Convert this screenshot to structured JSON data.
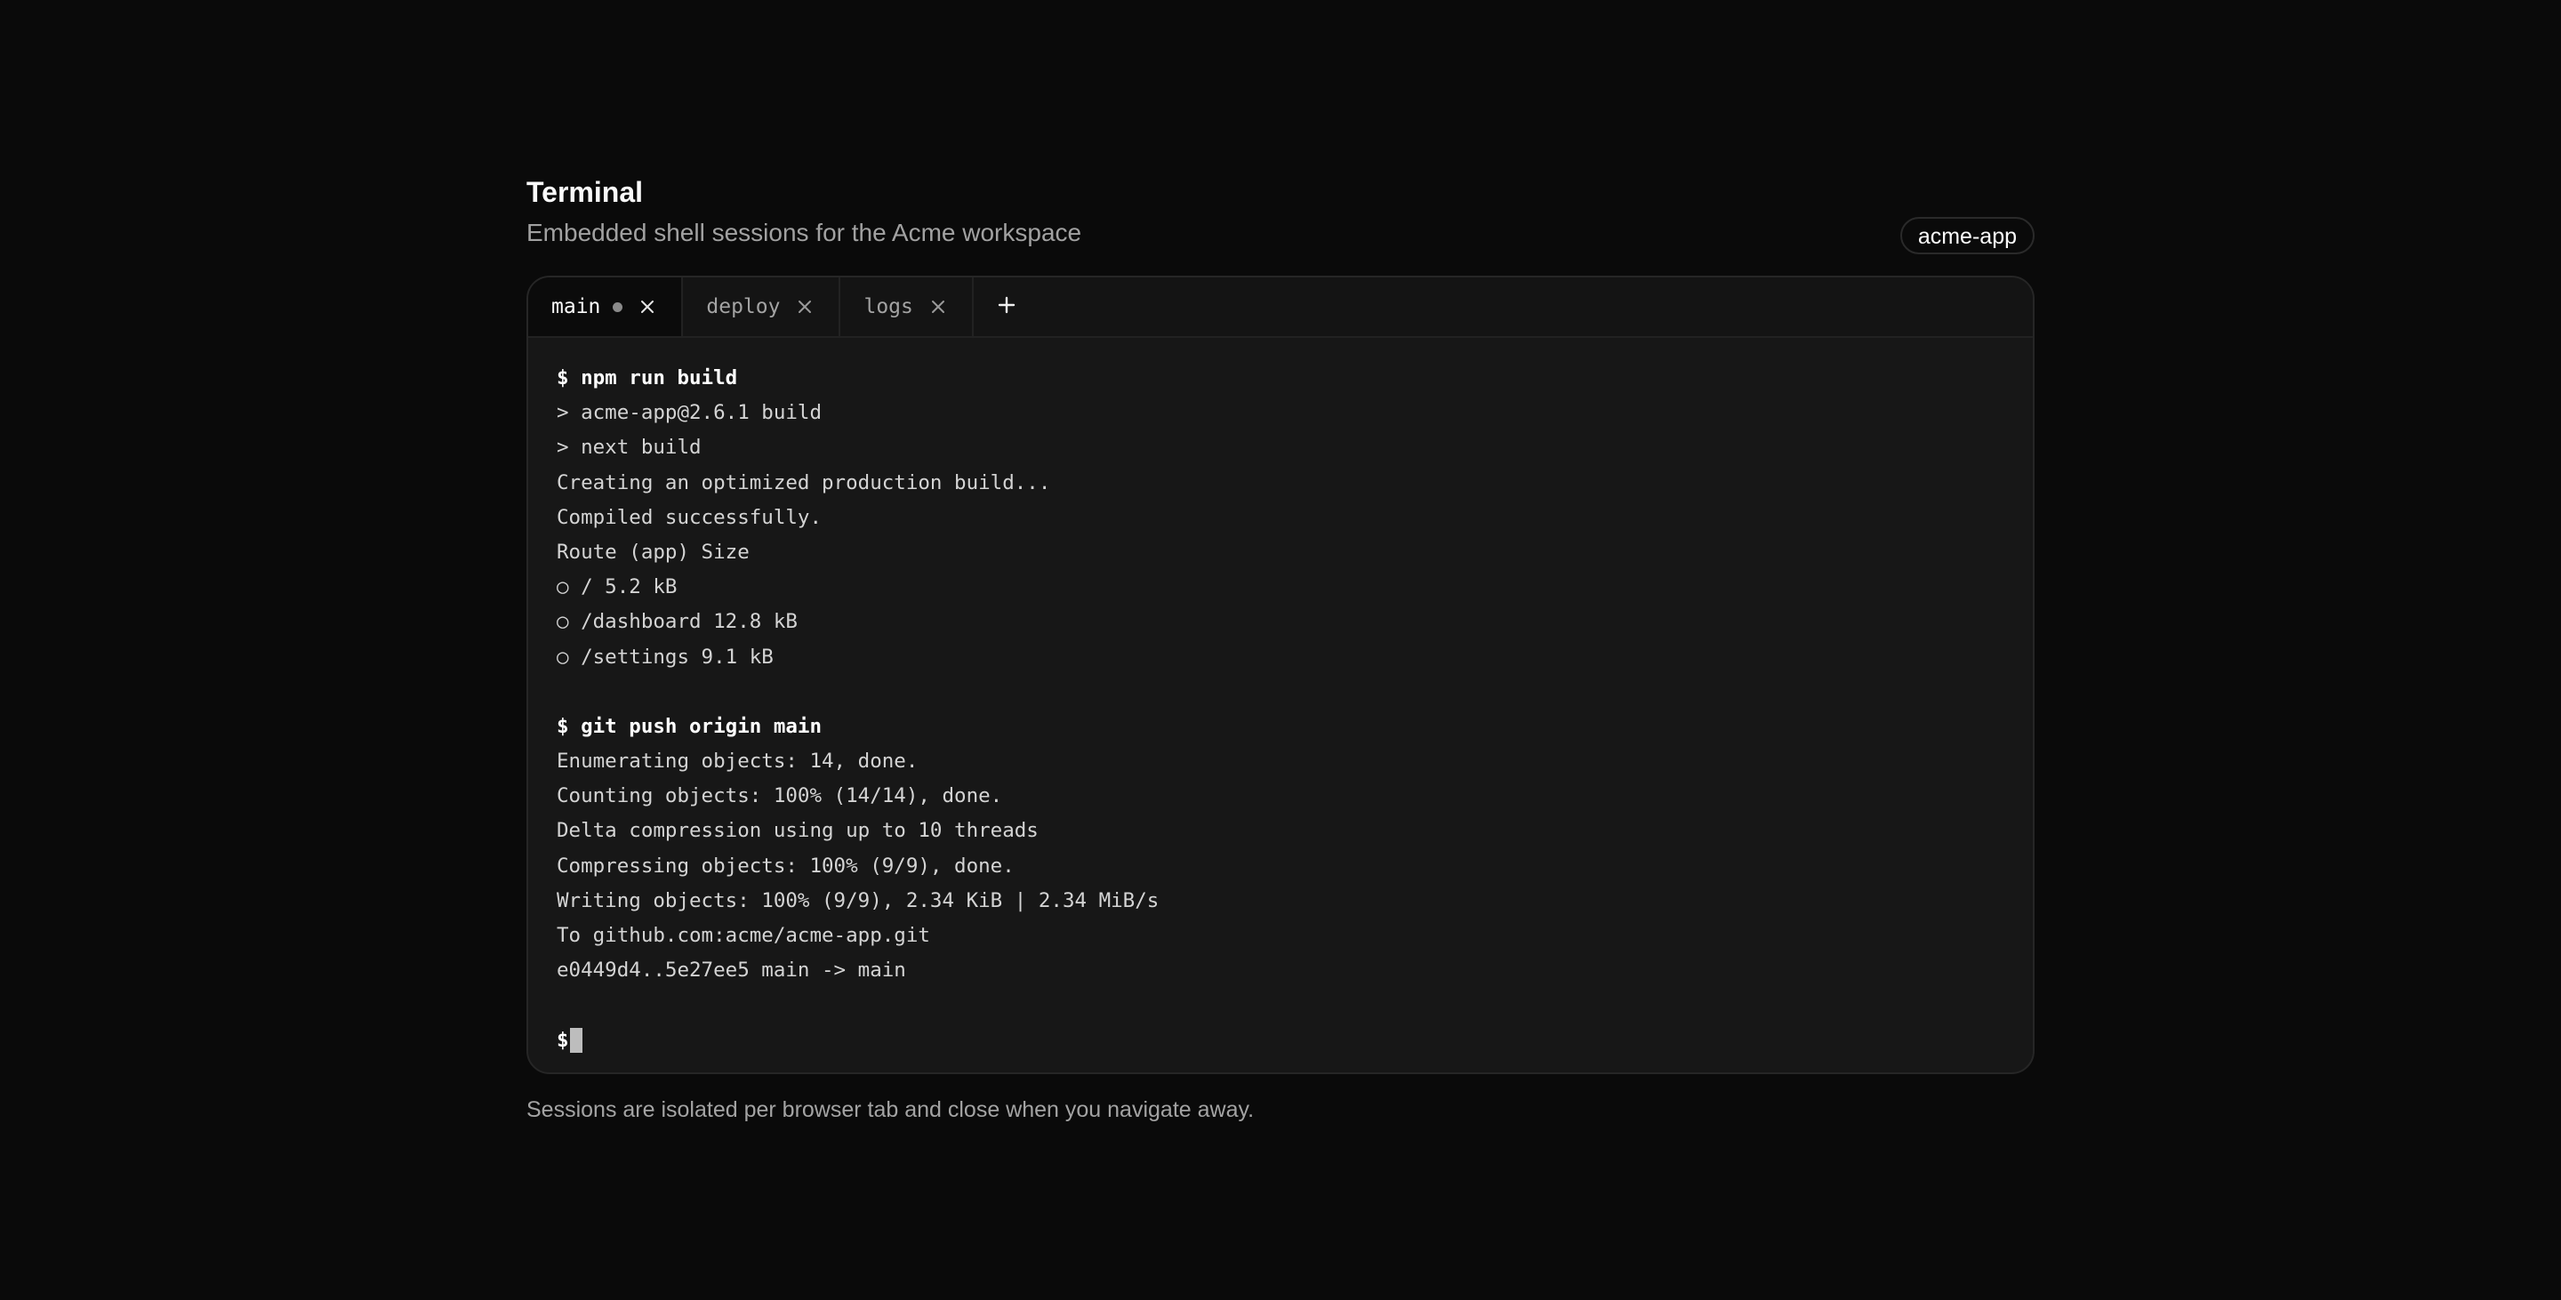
{
  "page": {
    "title": "Terminal",
    "subtitle": "Embedded shell sessions for the Acme workspace",
    "badge": "acme-app",
    "footer": "Sessions are isolated per browser tab and close when you navigate away."
  },
  "tabs": [
    {
      "label": "main",
      "active": true,
      "unsaved_dot": true
    },
    {
      "label": "deploy",
      "active": false
    },
    {
      "label": "logs",
      "active": false
    }
  ],
  "icons": {
    "close": "close-icon",
    "add": "plus-icon",
    "activity": "activity-dot-icon"
  },
  "terminal": {
    "blocks": [
      {
        "command": "$ npm run build",
        "output": [
          "> acme-app@2.6.1 build",
          "> next build",
          "Creating an optimized production build...",
          "Compiled successfully.",
          "Route (app) Size",
          "○ / 5.2 kB",
          "○ /dashboard 12.8 kB",
          "○ /settings 9.1 kB"
        ]
      },
      {
        "command": "$ git push origin main",
        "output": [
          "Enumerating objects: 14, done.",
          "Counting objects: 100% (14/14), done.",
          "Delta compression using up to 10 threads",
          "Compressing objects: 100% (9/9), done.",
          "Writing objects: 100% (9/9), 2.34 KiB | 2.34 MiB/s",
          "To github.com:acme/acme-app.git",
          "e0449d4..5e27ee5 main -> main"
        ]
      }
    ],
    "prompt": "$"
  },
  "colors": {
    "background": "#0a0a0a",
    "terminal_bg": "#171717",
    "text": "#d4d4d4",
    "muted": "#a3a3a3",
    "cursor": "#bdbdbd"
  }
}
